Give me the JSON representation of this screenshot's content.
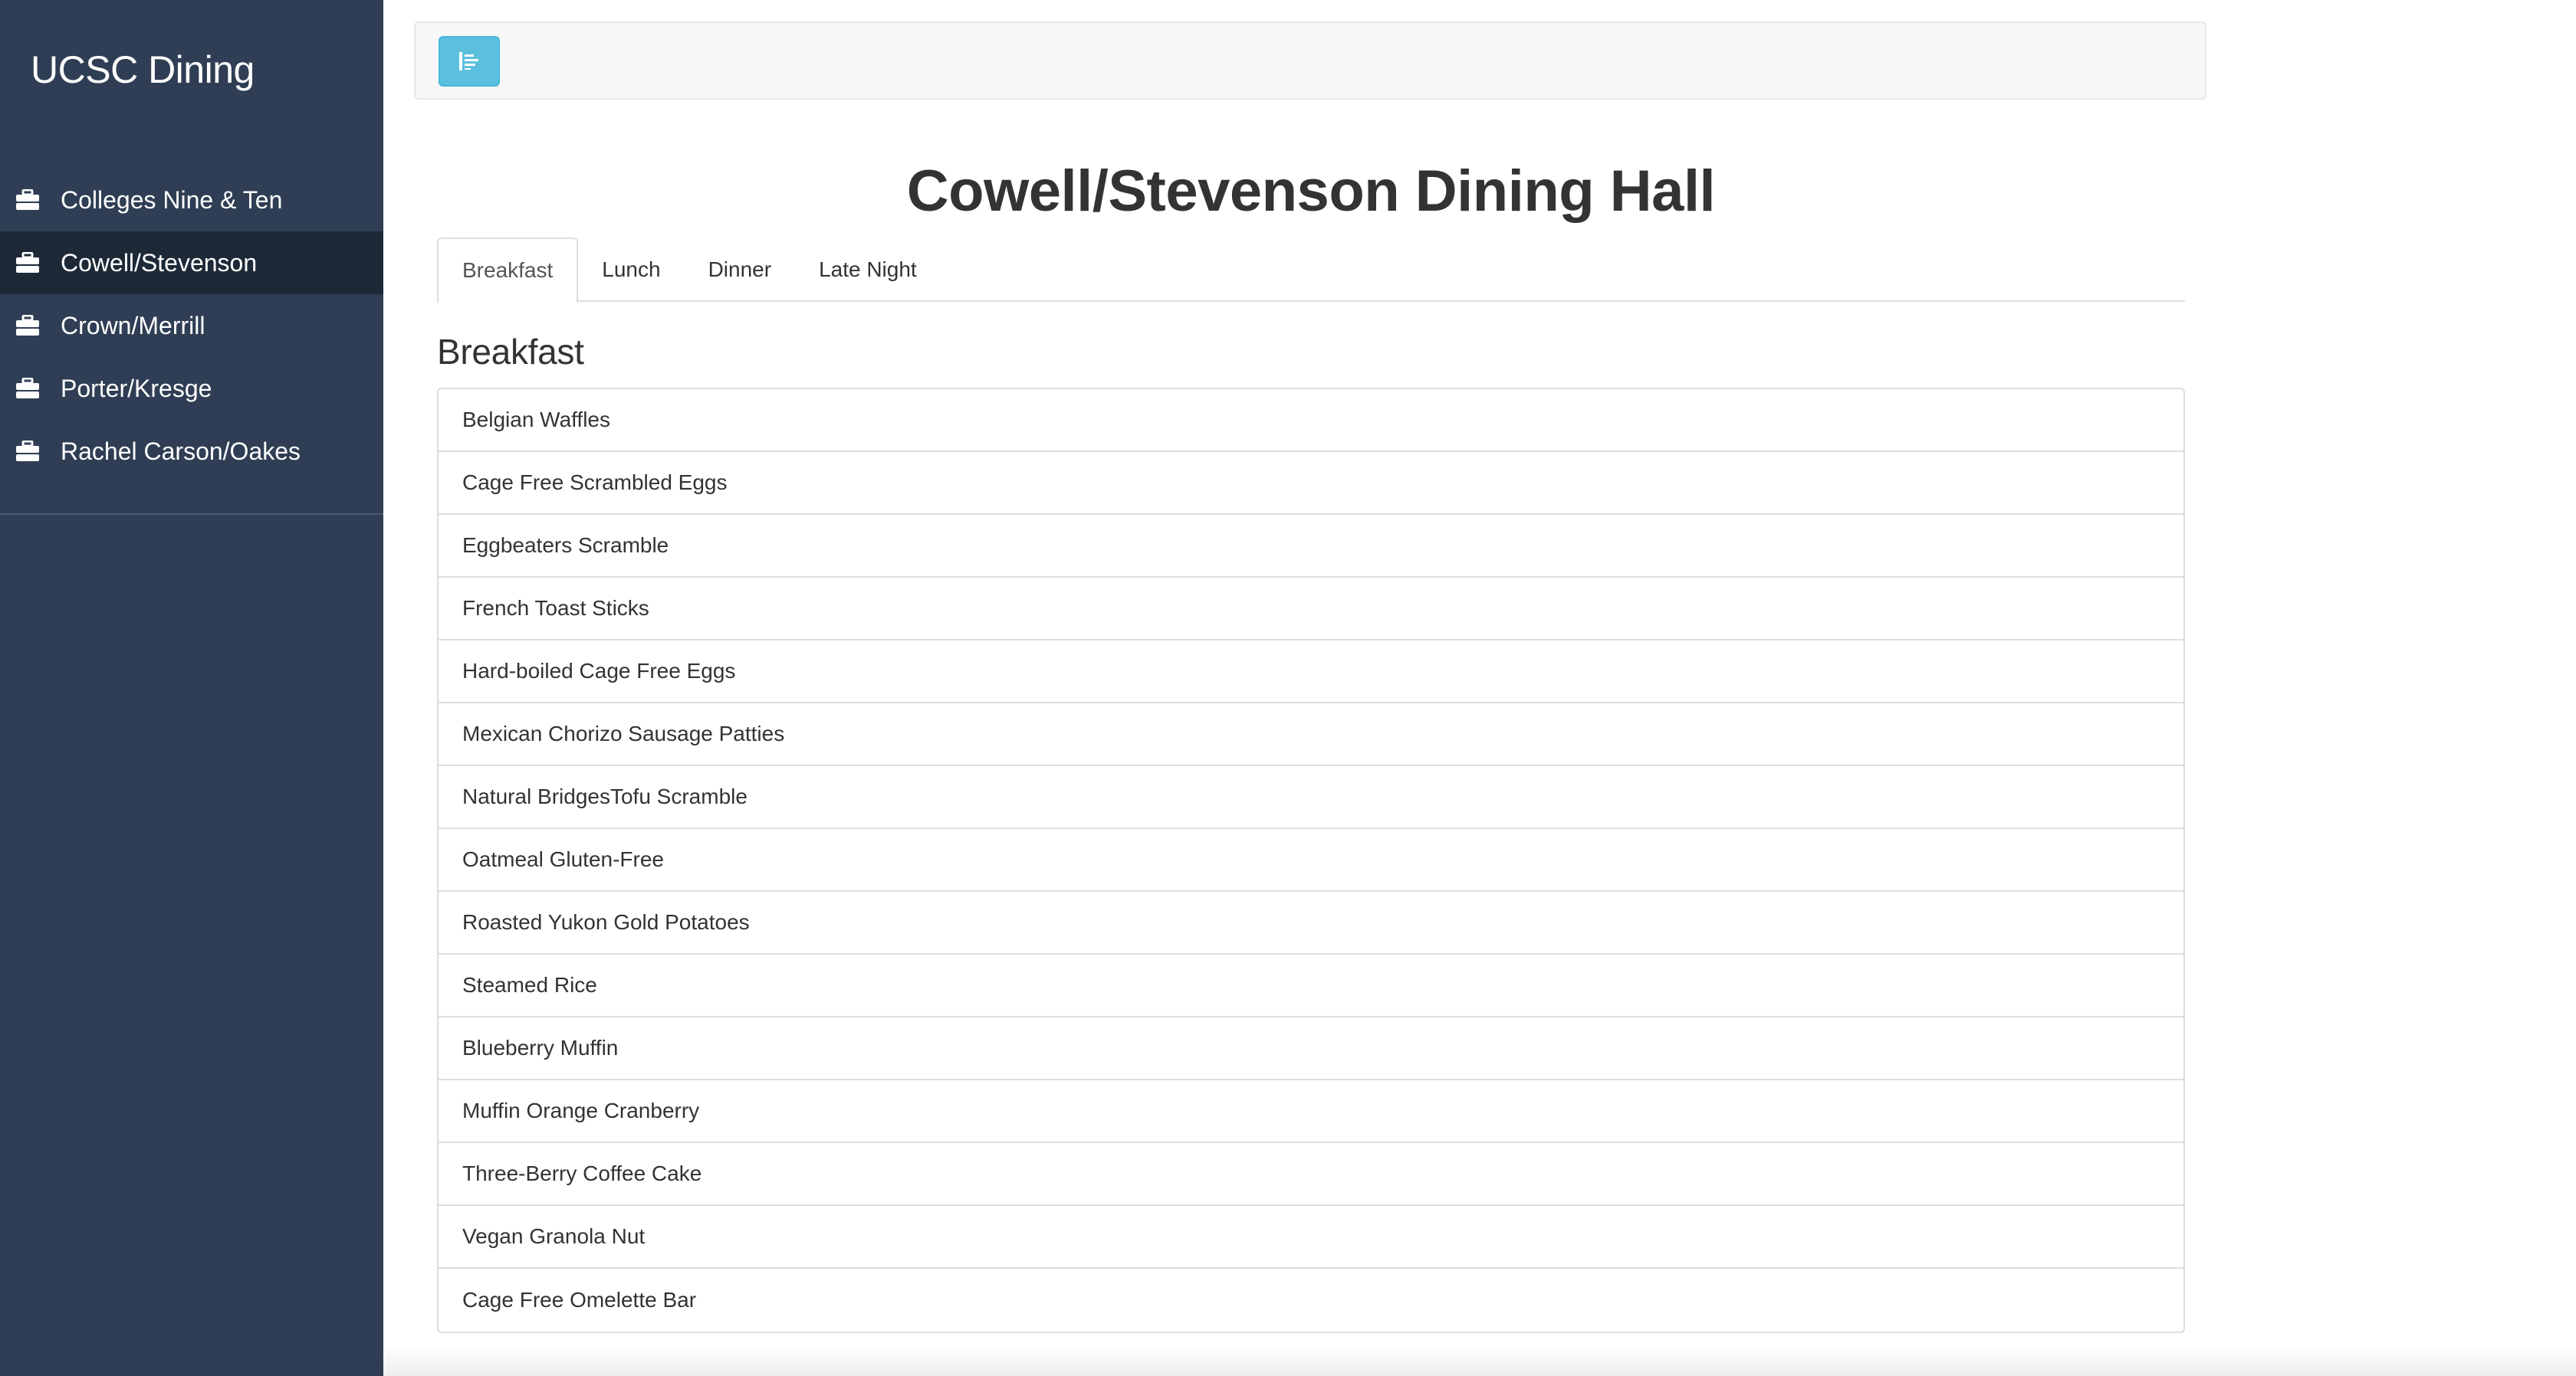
{
  "sidebar": {
    "brand": "UCSC Dining",
    "items": [
      {
        "label": "Colleges Nine & Ten",
        "icon": "briefcase-icon"
      },
      {
        "label": "Cowell/Stevenson",
        "icon": "briefcase-icon",
        "active": true
      },
      {
        "label": "Crown/Merrill",
        "icon": "briefcase-icon"
      },
      {
        "label": "Porter/Kresge",
        "icon": "briefcase-icon"
      },
      {
        "label": "Rachel Carson/Oakes",
        "icon": "briefcase-icon"
      }
    ]
  },
  "topbar": {
    "toggle_icon": "align-left-icon",
    "toggle_color": "#5bc0de"
  },
  "main": {
    "title": "Cowell/Stevenson Dining Hall",
    "tabs": [
      {
        "label": "Breakfast",
        "active": true
      },
      {
        "label": "Lunch"
      },
      {
        "label": "Dinner"
      },
      {
        "label": "Late Night"
      }
    ],
    "section_heading": "Breakfast",
    "menu_items": [
      "Belgian Waffles",
      "Cage Free Scrambled Eggs",
      "Eggbeaters Scramble",
      "French Toast Sticks",
      "Hard-boiled Cage Free Eggs",
      "Mexican Chorizo Sausage Patties",
      "Natural BridgesTofu Scramble",
      "Oatmeal Gluten-Free",
      "Roasted Yukon Gold Potatoes",
      "Steamed Rice",
      "Blueberry Muffin",
      "Muffin Orange Cranberry",
      "Three-Berry Coffee Cake",
      "Vegan Granola Nut",
      "Cage Free Omelette Bar"
    ]
  },
  "colors": {
    "sidebar_bg": "#2f3e54",
    "sidebar_active_bg": "#1e2938",
    "accent": "#5bc0de"
  }
}
